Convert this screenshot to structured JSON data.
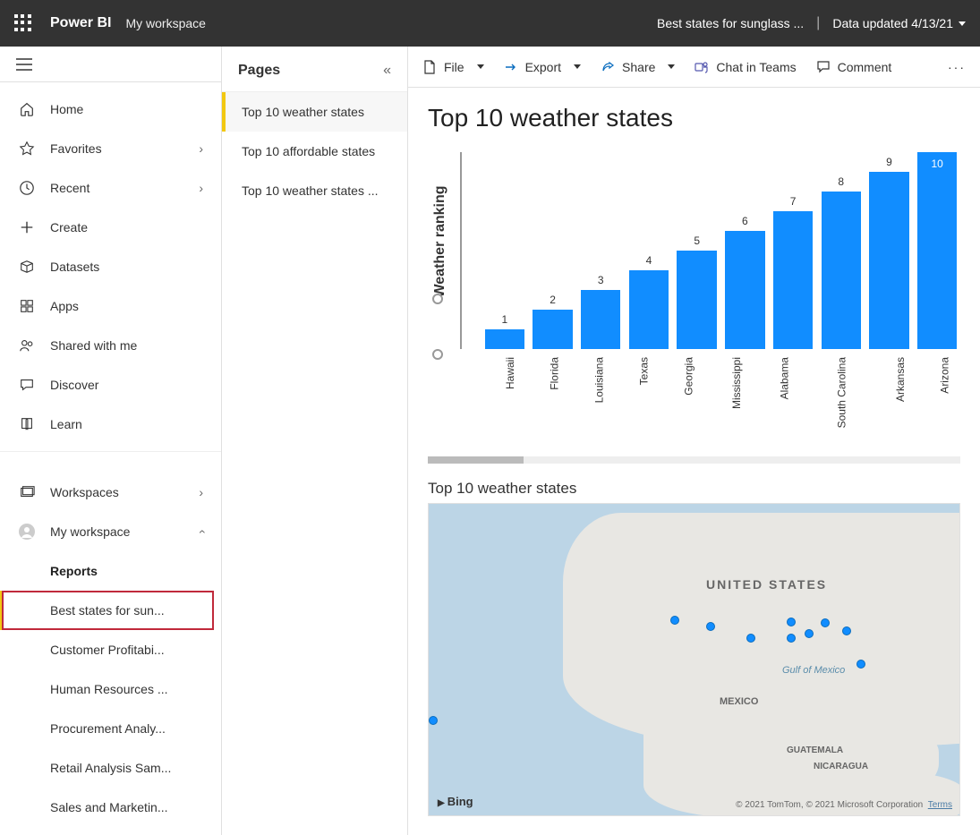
{
  "header": {
    "brand": "Power BI",
    "workspace": "My workspace",
    "breadcrumb": "Best states for sunglass ...",
    "data_updated": "Data updated 4/13/21"
  },
  "left_nav": {
    "items": [
      {
        "label": "Home",
        "icon": "home",
        "chevron": false
      },
      {
        "label": "Favorites",
        "icon": "star",
        "chevron": true
      },
      {
        "label": "Recent",
        "icon": "clock",
        "chevron": true
      },
      {
        "label": "Create",
        "icon": "plus",
        "chevron": false
      },
      {
        "label": "Datasets",
        "icon": "cube",
        "chevron": false
      },
      {
        "label": "Apps",
        "icon": "grid",
        "chevron": false
      },
      {
        "label": "Shared with me",
        "icon": "people",
        "chevron": false
      },
      {
        "label": "Discover",
        "icon": "chat",
        "chevron": false
      },
      {
        "label": "Learn",
        "icon": "book",
        "chevron": false
      }
    ],
    "workspaces_label": "Workspaces",
    "my_workspace_label": "My workspace",
    "reports_heading": "Reports",
    "reports": [
      {
        "label": "Best states for sun...",
        "selected": true
      },
      {
        "label": "Customer Profitabi..."
      },
      {
        "label": "Human Resources ..."
      },
      {
        "label": "Procurement Analy..."
      },
      {
        "label": "Retail Analysis Sam..."
      },
      {
        "label": "Sales and Marketin..."
      }
    ]
  },
  "pages": {
    "title": "Pages",
    "items": [
      {
        "label": "Top 10 weather states",
        "selected": true
      },
      {
        "label": "Top 10 affordable states"
      },
      {
        "label": "Top 10 weather states ..."
      }
    ]
  },
  "toolbar": {
    "file": "File",
    "export": "Export",
    "share": "Share",
    "chat": "Chat in Teams",
    "comment": "Comment"
  },
  "report": {
    "title": "Top 10 weather states",
    "map_title": "Top 10 weather states",
    "map_labels": {
      "usa": "UNITED STATES",
      "mexico": "MEXICO",
      "gulf": "Gulf of Mexico",
      "guatemala": "GUATEMALA",
      "nicaragua": "NICARAGUA"
    },
    "map_attr": "© 2021 TomTom, © 2021 Microsoft Corporation",
    "map_terms": "Terms",
    "bing": "Bing"
  },
  "chart_data": {
    "type": "bar",
    "title": "Top 10 weather states",
    "ylabel": "Weather ranking",
    "xlabel": "",
    "ylim": [
      0,
      10
    ],
    "categories": [
      "Hawaii",
      "Florida",
      "Louisiana",
      "Texas",
      "Georgia",
      "Mississippi",
      "Alabama",
      "South Carolina",
      "Arkansas",
      "Arizona"
    ],
    "values": [
      1,
      2,
      3,
      4,
      5,
      6,
      7,
      8,
      9,
      10
    ]
  }
}
